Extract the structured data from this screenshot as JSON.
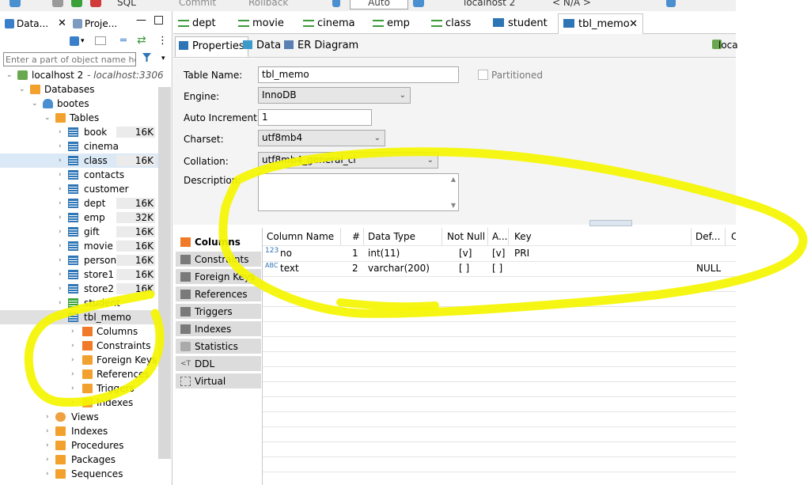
{
  "toolbar": {
    "sql_label": "SQL",
    "commit_label": "Commit",
    "rollback_label": "Rollback",
    "auto_label": "Auto",
    "connection_label": "localhost 2",
    "schema_label": "< N/A >"
  },
  "left": {
    "tabs": [
      {
        "label": "Data..."
      },
      {
        "label": "Proje..."
      }
    ],
    "filter_placeholder": "Enter a part of object name he",
    "tree": {
      "host": {
        "name": "localhost 2",
        "addr": "- localhost:3306"
      },
      "databases": "Databases",
      "db": "bootes",
      "tables": "Tables",
      "items": [
        {
          "name": "book",
          "size": "16K"
        },
        {
          "name": "cinema",
          "size": ""
        },
        {
          "name": "class",
          "size": "16K"
        },
        {
          "name": "contacts",
          "size": ""
        },
        {
          "name": "customer",
          "size": ""
        },
        {
          "name": "dept",
          "size": "16K"
        },
        {
          "name": "emp",
          "size": "32K"
        },
        {
          "name": "gift",
          "size": "16K"
        },
        {
          "name": "movie",
          "size": "16K"
        },
        {
          "name": "person",
          "size": "16K"
        },
        {
          "name": "store1",
          "size": "16K"
        },
        {
          "name": "store2",
          "size": "16K"
        },
        {
          "name": "student",
          "size": ""
        },
        {
          "name": "tbl_memo",
          "size": ""
        }
      ],
      "children": [
        "Columns",
        "Constraints",
        "Foreign Keys",
        "References",
        "Triggers",
        "Indexes"
      ],
      "db_children": [
        "Views",
        "Indexes",
        "Procedures",
        "Packages",
        "Sequences"
      ]
    }
  },
  "editor_tabs": [
    {
      "label": "dept"
    },
    {
      "label": "movie"
    },
    {
      "label": "cinema"
    },
    {
      "label": "emp"
    },
    {
      "label": "class"
    },
    {
      "label": "student"
    },
    {
      "label": "tbl_memo"
    }
  ],
  "subtabs": [
    {
      "label": "Properties"
    },
    {
      "label": "Data"
    },
    {
      "label": "ER Diagram"
    }
  ],
  "right_label": "loca",
  "props": {
    "table_name_label": "Table Name:",
    "table_name": "tbl_memo",
    "partitioned_label": "Partitioned",
    "engine_label": "Engine:",
    "engine": "InnoDB",
    "auto_inc_label": "Auto Increment:",
    "auto_inc": "1",
    "charset_label": "Charset:",
    "charset": "utf8mb4",
    "collation_label": "Collation:",
    "collation": "utf8mb4_general_ci",
    "description_label": "Description:"
  },
  "side_tabs": [
    {
      "label": "Columns"
    },
    {
      "label": "Constraints"
    },
    {
      "label": "Foreign Keys"
    },
    {
      "label": "References"
    },
    {
      "label": "Triggers"
    },
    {
      "label": "Indexes"
    },
    {
      "label": "Statistics"
    },
    {
      "label": "DDL"
    },
    {
      "label": "Virtual"
    }
  ],
  "grid": {
    "headers": [
      "Column Name",
      "#",
      "Data Type",
      "Not Null",
      "A...",
      "Key",
      "Def...",
      "C"
    ],
    "rows": [
      {
        "name": "no",
        "type_icon": "123",
        "num": "1",
        "data_type": "int(11)",
        "not_null": "[v]",
        "auto": "[v]",
        "key": "PRI",
        "default": ""
      },
      {
        "name": "text",
        "type_icon": "ABC",
        "num": "2",
        "data_type": "varchar(200)",
        "not_null": "[ ]",
        "auto": "[ ]",
        "key": "",
        "default": "NULL"
      }
    ]
  },
  "colors": {
    "highlighter": "#f5f500",
    "selection": "#dbe8f5",
    "accent": "#2e75b6"
  }
}
